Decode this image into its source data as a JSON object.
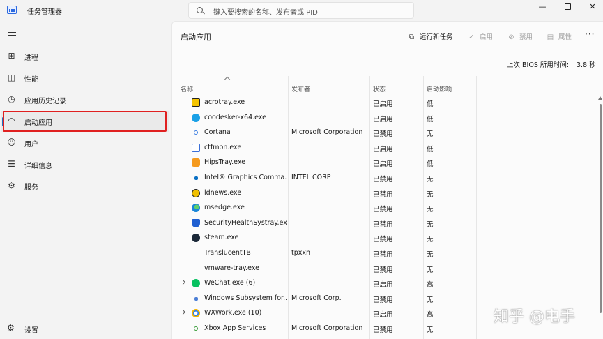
{
  "window": {
    "title": "任务管理器",
    "search_placeholder": "键入要搜索的名称、发布者或 PID",
    "minimize": "—",
    "close": "✕"
  },
  "nav": {
    "items": [
      {
        "label": "进程",
        "icon": "processes-icon"
      },
      {
        "label": "性能",
        "icon": "performance-icon"
      },
      {
        "label": "应用历史记录",
        "icon": "app-history-icon"
      },
      {
        "label": "启动应用",
        "icon": "startup-apps-icon",
        "active": true
      },
      {
        "label": "用户",
        "icon": "users-icon"
      },
      {
        "label": "详细信息",
        "icon": "details-icon"
      },
      {
        "label": "服务",
        "icon": "services-icon"
      }
    ],
    "settings_label": "设置"
  },
  "page": {
    "title": "启动应用",
    "toolbar": {
      "run_new_task": "运行新任务",
      "enable": "启用",
      "disable": "禁用",
      "properties": "属性",
      "more": "···"
    },
    "bios_label": "上次 BIOS 所用时间:",
    "bios_value": "3.8 秒"
  },
  "table": {
    "headers": {
      "name": "名称",
      "publisher": "发布者",
      "status": "状态",
      "impact": "启动影响"
    },
    "rows": [
      {
        "name": "acrotray.exe",
        "publisher": "",
        "status": "已启用",
        "impact": "低",
        "icon": "acrotray-icon"
      },
      {
        "name": "coodesker-x64.exe",
        "publisher": "",
        "status": "已启用",
        "impact": "低",
        "icon": "coodesker-icon"
      },
      {
        "name": "Cortana",
        "publisher": "Microsoft Corporation",
        "status": "已禁用",
        "impact": "无",
        "icon": "cortana-icon"
      },
      {
        "name": "ctfmon.exe",
        "publisher": "",
        "status": "已启用",
        "impact": "低",
        "icon": "ctfmon-icon"
      },
      {
        "name": "HipsTray.exe",
        "publisher": "",
        "status": "已启用",
        "impact": "低",
        "icon": "hipstray-icon"
      },
      {
        "name": "Intel® Graphics Comma...",
        "publisher": "INTEL CORP",
        "status": "已禁用",
        "impact": "无",
        "icon": "intel-graphics-icon"
      },
      {
        "name": "ldnews.exe",
        "publisher": "",
        "status": "已禁用",
        "impact": "无",
        "icon": "ldnews-icon"
      },
      {
        "name": "msedge.exe",
        "publisher": "",
        "status": "已禁用",
        "impact": "无",
        "icon": "edge-icon"
      },
      {
        "name": "SecurityHealthSystray.exe",
        "publisher": "",
        "status": "已禁用",
        "impact": "无",
        "icon": "security-health-icon"
      },
      {
        "name": "steam.exe",
        "publisher": "",
        "status": "已禁用",
        "impact": "无",
        "icon": "steam-icon"
      },
      {
        "name": "TranslucentTB",
        "publisher": "tpxxn",
        "status": "已禁用",
        "impact": "无",
        "icon": ""
      },
      {
        "name": "vmware-tray.exe",
        "publisher": "",
        "status": "已禁用",
        "impact": "无",
        "icon": ""
      },
      {
        "name": "WeChat.exe (6)",
        "publisher": "",
        "status": "已启用",
        "impact": "高",
        "icon": "wechat-icon",
        "expandable": true
      },
      {
        "name": "Windows Subsystem for...",
        "publisher": "Microsoft Corp.",
        "status": "已禁用",
        "impact": "无",
        "icon": "wsl-icon"
      },
      {
        "name": "WXWork.exe (10)",
        "publisher": "",
        "status": "已启用",
        "impact": "高",
        "icon": "wxwork-icon",
        "expandable": true
      },
      {
        "name": "Xbox App Services",
        "publisher": "Microsoft Corporation",
        "status": "已禁用",
        "impact": "无",
        "icon": "xbox-icon"
      }
    ]
  },
  "watermark": "知乎 @电手"
}
